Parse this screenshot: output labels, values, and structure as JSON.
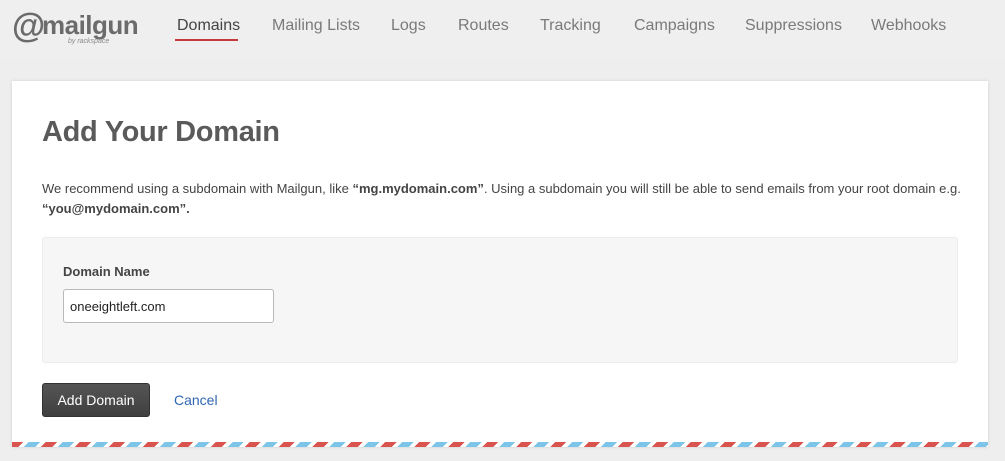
{
  "logo": {
    "at_symbol": "@",
    "wordmark": "mailgun",
    "subtitle": "by rackspace"
  },
  "nav": {
    "items": [
      {
        "label": "Domains",
        "active": true
      },
      {
        "label": "Mailing Lists",
        "active": false
      },
      {
        "label": "Logs",
        "active": false
      },
      {
        "label": "Routes",
        "active": false
      },
      {
        "label": "Tracking",
        "active": false
      },
      {
        "label": "Campaigns",
        "active": false
      },
      {
        "label": "Suppressions",
        "active": false
      },
      {
        "label": "Webhooks",
        "active": false
      }
    ]
  },
  "page": {
    "title": "Add Your Domain",
    "desc_part1": "We recommend using a subdomain with Mailgun, like ",
    "desc_example1": "“mg.mydomain.com”",
    "desc_part2": ". Using a subdomain you will still be able to send emails from your root domain e.g. ",
    "desc_example2": "“you@mydomain.com”."
  },
  "form": {
    "domain_label": "Domain Name",
    "domain_value": "oneeightleft.com",
    "submit_label": "Add Domain",
    "cancel_label": "Cancel"
  },
  "colors": {
    "accent_underline": "#c43a3a",
    "link": "#2f66b3",
    "button": "#4a4a4a",
    "airmail_red": "#d9534f",
    "airmail_blue": "#7cc4e8"
  }
}
